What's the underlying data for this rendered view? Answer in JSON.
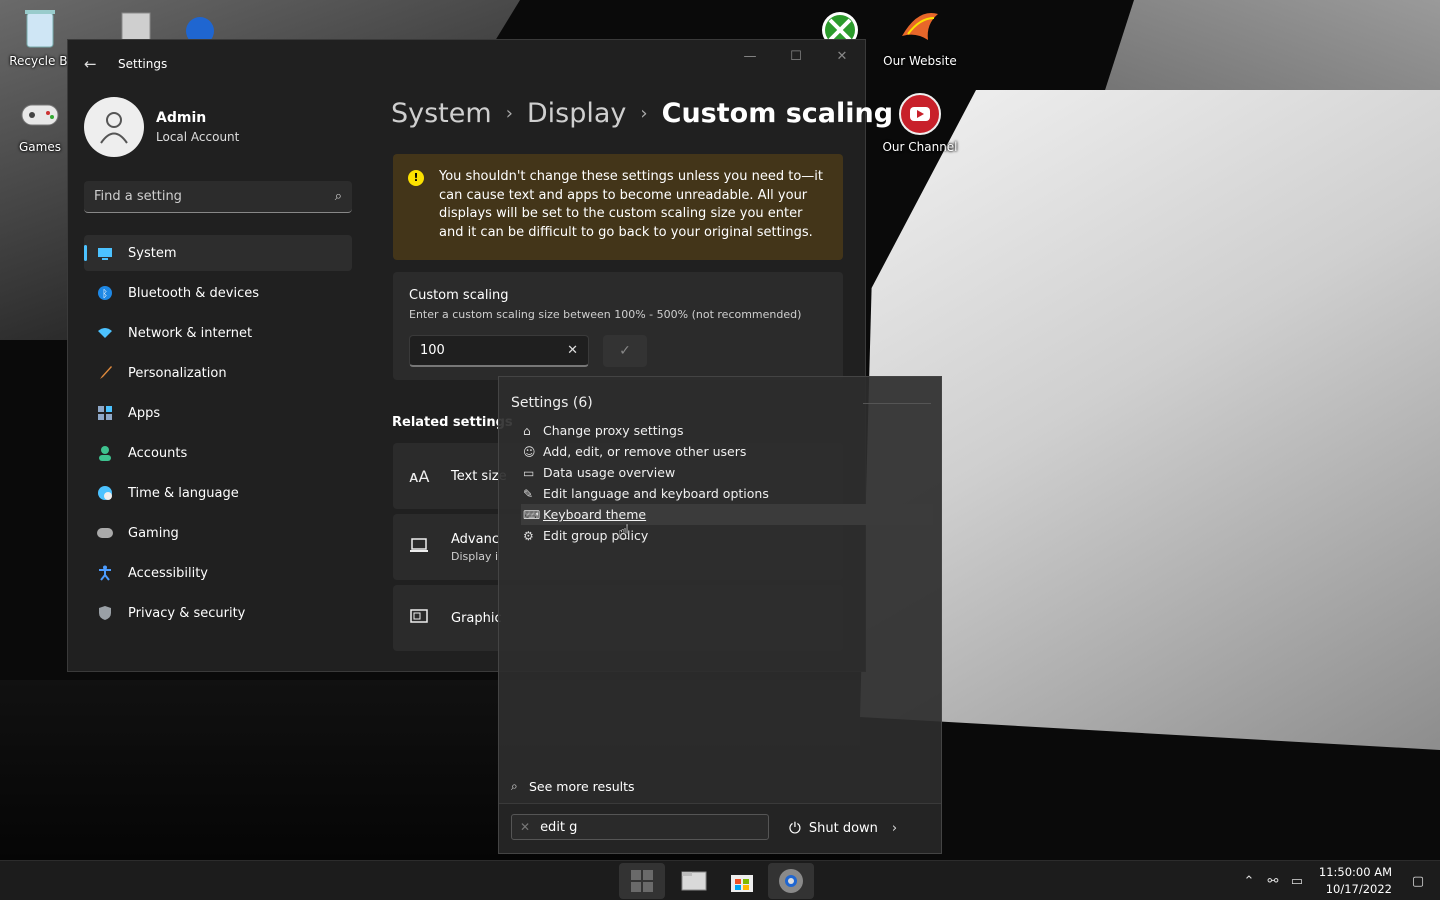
{
  "desktop": {
    "icons": [
      {
        "label": "Recycle Bi",
        "icon": "recycle-bin-icon"
      },
      {
        "label": "Games",
        "icon": "gamepad-icon"
      },
      {
        "label": "Our Website",
        "icon": "phoenix-logo-icon"
      },
      {
        "label": "Our Channel",
        "icon": "youtube-icon"
      }
    ]
  },
  "window": {
    "title": "Settings",
    "profile": {
      "name": "Admin",
      "account_type": "Local Account"
    },
    "search": {
      "placeholder": "Find a setting"
    },
    "nav": [
      {
        "label": "System",
        "active": true,
        "icon": "monitor-icon",
        "color": "#4cc2ff"
      },
      {
        "label": "Bluetooth & devices",
        "icon": "bluetooth-icon",
        "color": "#1e88e5"
      },
      {
        "label": "Network & internet",
        "icon": "wifi-icon",
        "color": "#4cc2ff"
      },
      {
        "label": "Personalization",
        "icon": "brush-icon",
        "color": "#e08a3c"
      },
      {
        "label": "Apps",
        "icon": "apps-icon",
        "color": "#8fa8c8"
      },
      {
        "label": "Accounts",
        "icon": "person-icon",
        "color": "#3ec28f"
      },
      {
        "label": "Time & language",
        "icon": "globe-clock-icon",
        "color": "#4cc2ff"
      },
      {
        "label": "Gaming",
        "icon": "controller-icon",
        "color": "#aaaaaa"
      },
      {
        "label": "Accessibility",
        "icon": "accessibility-icon",
        "color": "#4c9cff"
      },
      {
        "label": "Privacy & security",
        "icon": "shield-icon",
        "color": "#9aa0a6"
      }
    ],
    "breadcrumb": {
      "level1": "System",
      "level2": "Display",
      "current": "Custom scaling",
      "separator": "›"
    },
    "warning": {
      "text": "You shouldn't change these settings unless you need to—it can cause text and apps to become unreadable. All your displays will be set to the custom scaling size you enter and it can be difficult to go back to your original settings."
    },
    "custom_scaling": {
      "title": "Custom scaling",
      "subtitle": "Enter a custom scaling size between 100% - 500% (not recommended)",
      "value": "100"
    },
    "related": {
      "heading": "Related settings",
      "items": [
        {
          "title": "Text size",
          "subtitle": "",
          "icon": "text-size-icon"
        },
        {
          "title": "Advanc",
          "subtitle": "Display i",
          "icon": "laptop-icon"
        },
        {
          "title": "Graphic",
          "subtitle": "",
          "icon": "graphics-card-icon"
        }
      ]
    }
  },
  "start_flyout": {
    "group_label": "Settings (6)",
    "results": [
      {
        "label": "Change proxy settings",
        "icon": "proxy-icon"
      },
      {
        "label": "Add, edit, or remove other users",
        "icon": "users-icon"
      },
      {
        "label": "Data usage overview",
        "icon": "data-usage-icon"
      },
      {
        "label": "Edit language and keyboard options",
        "icon": "language-icon"
      },
      {
        "label": "Keyboard theme",
        "icon": "keyboard-icon",
        "hover": true
      },
      {
        "label": "Edit group policy",
        "icon": "group-policy-icon"
      }
    ],
    "see_more": "See more results",
    "search_value": "edit g",
    "shutdown_label": "Shut down"
  },
  "taskbar": {
    "apps": [
      "start-icon",
      "file-explorer-icon",
      "store-icon",
      "settings-gear-icon"
    ],
    "time": "11:50:00 AM",
    "date": "10/17/2022"
  }
}
